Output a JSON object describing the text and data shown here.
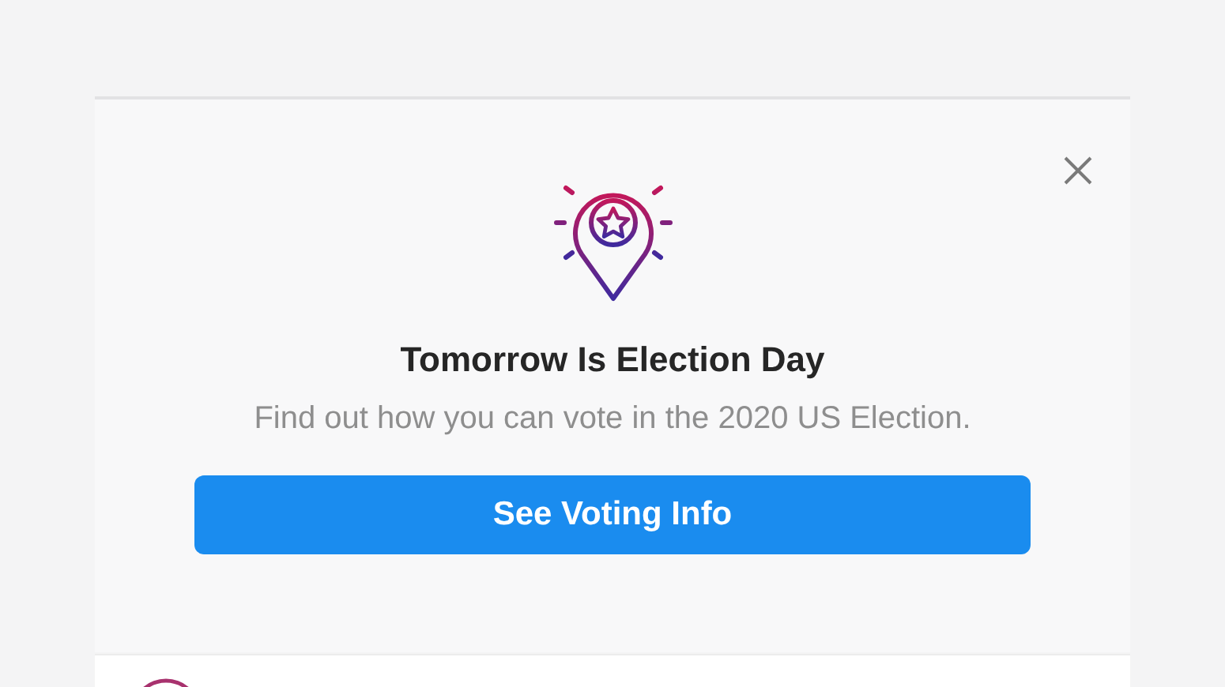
{
  "prompt": {
    "title": "Tomorrow Is Election Day",
    "message": "Find out how you can vote in the 2020 US Election.",
    "button": "See Voting Info"
  }
}
